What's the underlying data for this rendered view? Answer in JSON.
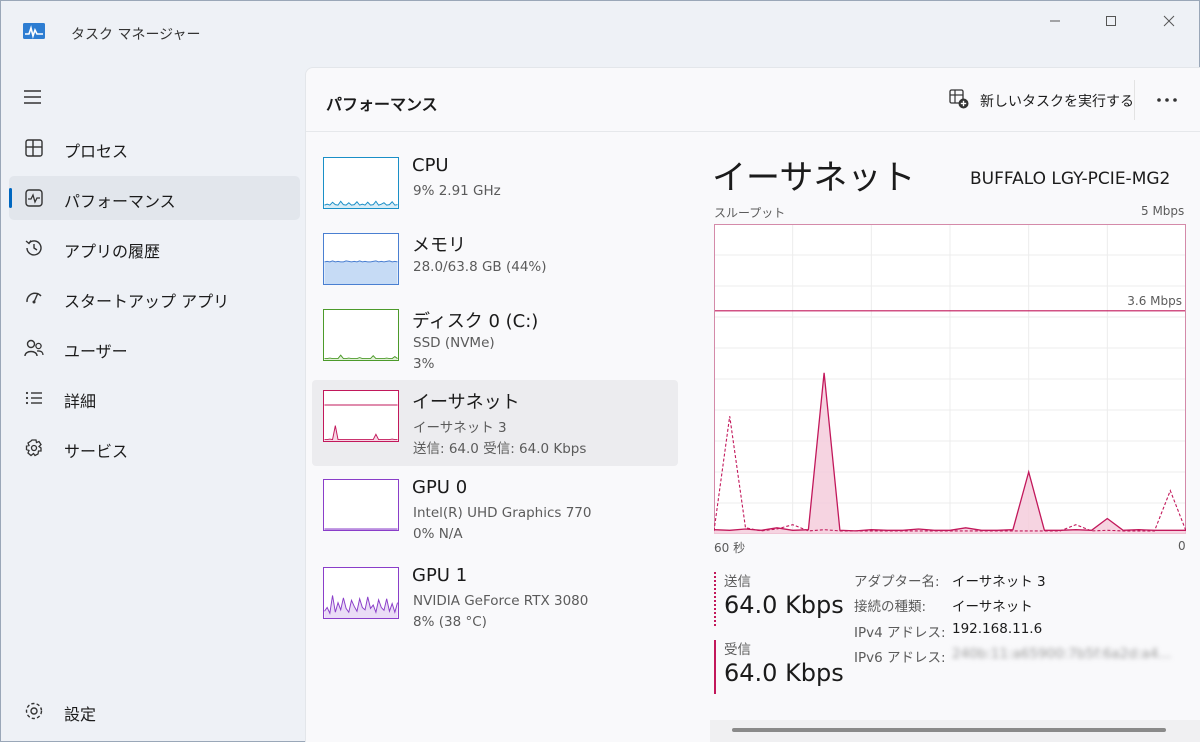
{
  "window": {
    "title": "タスク マネージャー"
  },
  "nav": {
    "items": [
      {
        "label": "プロセス",
        "icon": "processes-icon"
      },
      {
        "label": "パフォーマンス",
        "icon": "performance-icon"
      },
      {
        "label": "アプリの履歴",
        "icon": "history-icon"
      },
      {
        "label": "スタートアップ アプリ",
        "icon": "startup-icon"
      },
      {
        "label": "ユーザー",
        "icon": "users-icon"
      },
      {
        "label": "詳細",
        "icon": "details-icon"
      },
      {
        "label": "サービス",
        "icon": "services-icon"
      }
    ],
    "settings_label": "設定"
  },
  "header": {
    "title": "パフォーマンス",
    "run_task_label": "新しいタスクを実行する"
  },
  "devices": [
    {
      "name": "CPU",
      "line1": "9%  2.91 GHz",
      "line2": "",
      "color": "#1a8fc7",
      "fill": "#d8edf7"
    },
    {
      "name": "メモリ",
      "line1": "28.0/63.8 GB (44%)",
      "line2": "",
      "color": "#4a7fd1",
      "fill": "#c6dbf5"
    },
    {
      "name": "ディスク 0 (C:)",
      "line1": "SSD (NVMe)",
      "line2": "3%",
      "color": "#4c9a2a",
      "fill": "#e3f1d9"
    },
    {
      "name": "イーサネット",
      "line1": "イーサネット 3",
      "line2": "送信: 64.0  受信: 64.0 Kbps",
      "color": "#c2185b",
      "fill": "#f6d6e3"
    },
    {
      "name": "GPU 0",
      "line1": "Intel(R) UHD Graphics 770",
      "line2": "0%  N/A",
      "color": "#8a3ec9",
      "fill": "#eadcf6"
    },
    {
      "name": "GPU 1",
      "line1": "NVIDIA GeForce RTX 3080",
      "line2": "8%  (38 °C)",
      "color": "#8a3ec9",
      "fill": "#eadcf6"
    }
  ],
  "detail": {
    "title": "イーサネット",
    "adapter": "BUFFALO LGY-PCIE-MG2",
    "graph_label": "スループット",
    "graph_max": "5 Mbps",
    "graph_time_left": "60 秒",
    "graph_time_right": "0",
    "send_label": "送信",
    "send_value": "64.0 Kbps",
    "recv_label": "受信",
    "recv_value": "64.0 Kbps",
    "props": [
      {
        "key": "アダプター名:",
        "value": "イーサネット 3"
      },
      {
        "key": "接続の種類:",
        "value": "イーサネット"
      },
      {
        "key": "IPv4 アドレス:",
        "value": "192.168.11.6"
      },
      {
        "key": "IPv6 アドレス:",
        "value": "240b:11:a65900:7b5f:6a2d:a4..."
      }
    ]
  },
  "chart_data": {
    "type": "area",
    "title": "",
    "xlabel": "",
    "ylabel": "スループット",
    "xlim": [
      60,
      0
    ],
    "ylim": [
      0,
      5
    ],
    "reference_line": {
      "value": 3.6,
      "label": "3.6 Mbps"
    },
    "x": [
      60,
      58,
      56,
      54,
      52,
      50,
      48,
      46,
      44,
      42,
      40,
      38,
      36,
      34,
      32,
      30,
      28,
      26,
      24,
      22,
      20,
      18,
      16,
      14,
      12,
      10,
      8,
      6,
      4,
      2,
      0
    ],
    "series": [
      {
        "name": "受信",
        "style": "solid-fill",
        "color": "#c2185b",
        "values": [
          0.07,
          0.06,
          0.08,
          0.06,
          0.1,
          0.06,
          0.07,
          2.6,
          0.06,
          0.05,
          0.07,
          0.06,
          0.06,
          0.08,
          0.06,
          0.06,
          0.1,
          0.06,
          0.06,
          0.07,
          1.0,
          0.06,
          0.06,
          0.07,
          0.06,
          0.25,
          0.06,
          0.07,
          0.06,
          0.06,
          0.06
        ]
      },
      {
        "name": "送信",
        "style": "dashed",
        "color": "#c2185b",
        "values": [
          0.05,
          1.9,
          0.1,
          0.05,
          0.08,
          0.15,
          0.05,
          0.07,
          0.05,
          0.05,
          0.05,
          0.05,
          0.05,
          0.05,
          0.05,
          0.05,
          0.05,
          0.05,
          0.05,
          0.05,
          0.05,
          0.05,
          0.05,
          0.15,
          0.05,
          0.06,
          0.05,
          0.05,
          0.05,
          0.7,
          0.05
        ]
      }
    ]
  }
}
